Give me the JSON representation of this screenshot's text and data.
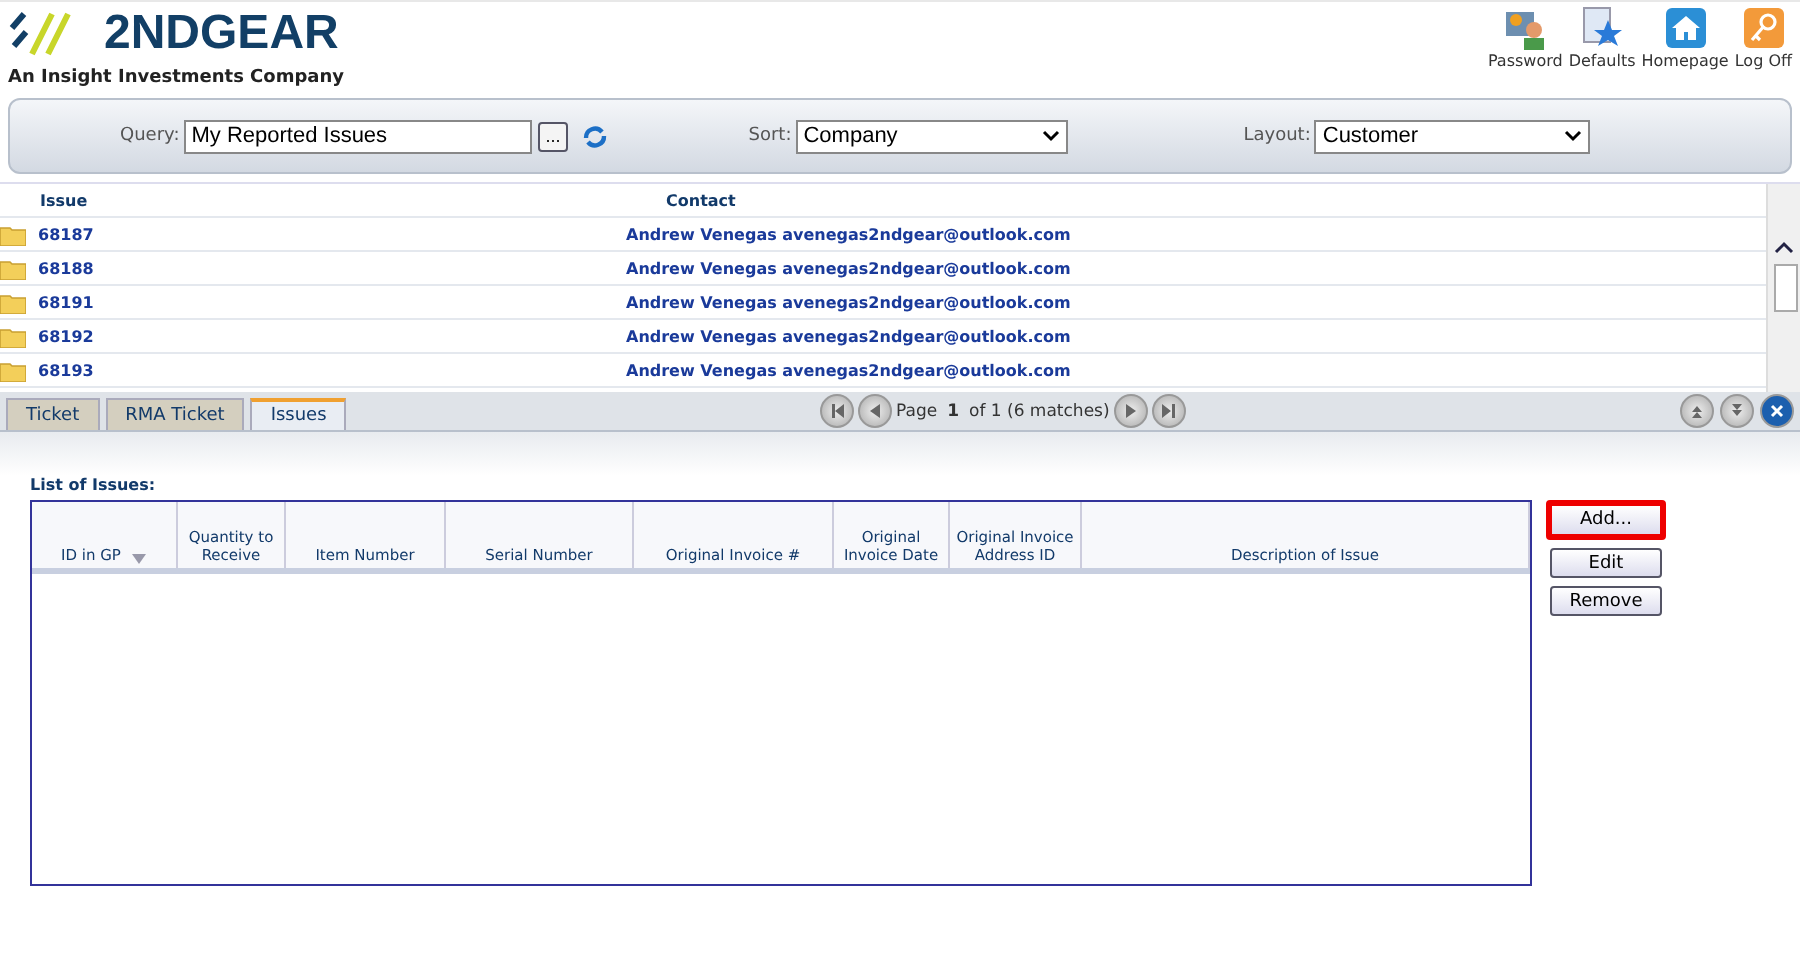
{
  "brand": {
    "name": "2NDGEAR",
    "tagline": "An Insight Investments Company"
  },
  "header_actions": [
    {
      "label": "Password",
      "kind": "password"
    },
    {
      "label": "Defaults",
      "kind": "defaults"
    },
    {
      "label": "Homepage",
      "kind": "home"
    },
    {
      "label": "Log Off",
      "kind": "logoff"
    }
  ],
  "filters": {
    "query_label": "Query:",
    "query": "My Reported Issues",
    "browse_button": "...",
    "sort_label": "Sort:",
    "sort": "Company",
    "layout_label": "Layout:",
    "layout": "Customer"
  },
  "issues_table": {
    "columns": [
      "Issue",
      "Contact"
    ],
    "rows": [
      {
        "issue": "68187",
        "contact": "Andrew Venegas avenegas2ndgear@outlook.com"
      },
      {
        "issue": "68188",
        "contact": "Andrew Venegas avenegas2ndgear@outlook.com"
      },
      {
        "issue": "68191",
        "contact": "Andrew Venegas avenegas2ndgear@outlook.com"
      },
      {
        "issue": "68192",
        "contact": "Andrew Venegas avenegas2ndgear@outlook.com"
      },
      {
        "issue": "68193",
        "contact": "Andrew Venegas avenegas2ndgear@outlook.com"
      }
    ]
  },
  "tabs": [
    {
      "label": "Ticket",
      "selected": false
    },
    {
      "label": "RMA Ticket",
      "selected": false
    },
    {
      "label": "Issues",
      "selected": true
    }
  ],
  "pager": {
    "page_label": "Page",
    "page": "1",
    "of_text": "of 1 (6 matches)"
  },
  "issues_list": {
    "title": "List of Issues:",
    "columns": [
      {
        "label": "ID in GP",
        "sorted": true
      },
      {
        "label": "Quantity to Receive",
        "sorted": false
      },
      {
        "label": "Item Number",
        "sorted": false
      },
      {
        "label": "Serial Number",
        "sorted": false
      },
      {
        "label": "Original Invoice #",
        "sorted": false
      },
      {
        "label": "Original Invoice Date",
        "sorted": false
      },
      {
        "label": "Original Invoice Address ID",
        "sorted": false
      },
      {
        "label": "Description of Issue",
        "sorted": false
      }
    ]
  },
  "buttons": [
    {
      "label": "Add...",
      "highlighted": true
    },
    {
      "label": "Edit",
      "highlighted": false
    },
    {
      "label": "Remove",
      "highlighted": false
    }
  ]
}
